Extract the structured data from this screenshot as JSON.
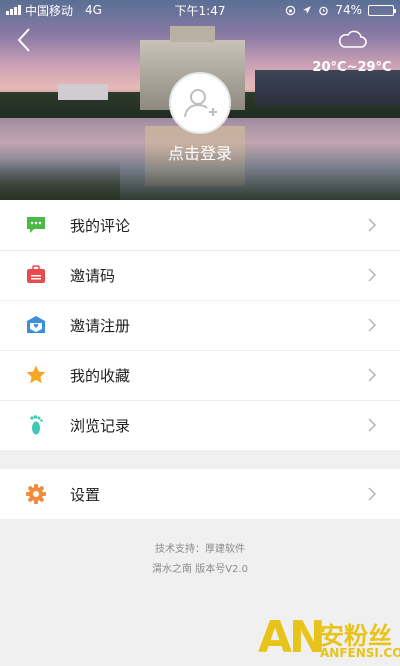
{
  "status_bar": {
    "carrier": "中国移动",
    "network": "4G",
    "time": "下午1:47",
    "battery_percent": "74%",
    "battery_level": 0.74
  },
  "header": {
    "weather_icon": "cloud-icon",
    "temperature": "20°C~29°C",
    "login_label": "点击登录"
  },
  "menu": {
    "items": [
      {
        "label": "我的评论",
        "icon": "comment-icon",
        "color": "#4cb944"
      },
      {
        "label": "邀请码",
        "icon": "invite-code-icon",
        "color": "#e84b4b"
      },
      {
        "label": "邀请注册",
        "icon": "invite-register-icon",
        "color": "#3a8fd9"
      },
      {
        "label": "我的收藏",
        "icon": "star-icon",
        "color": "#f5a623"
      },
      {
        "label": "浏览记录",
        "icon": "footprint-icon",
        "color": "#3ec9b5"
      }
    ]
  },
  "settings": {
    "label": "设置",
    "icon": "gear-icon",
    "color": "#f08c3c"
  },
  "footer": {
    "tech_support": "技术支持：厚建软件",
    "version": "渭水之南  版本号V2.0"
  },
  "watermark": {
    "logo": "AN",
    "text_cn": "安粉丝",
    "text_en": "ANFENSI.COM"
  }
}
